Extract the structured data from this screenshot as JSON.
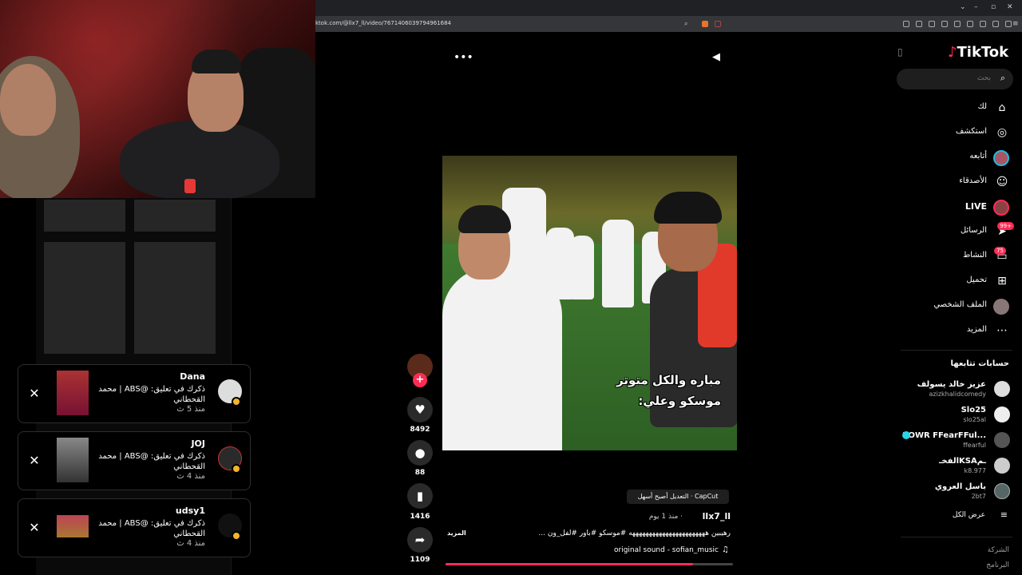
{
  "browser": {
    "url": "ktok.com/@llx7_ll/video/7671406039794961684"
  },
  "tiktok": {
    "logo": "TikTok",
    "search_placeholder": "بحث",
    "nav": [
      {
        "label": "لك",
        "icon": "home-icon"
      },
      {
        "label": "استكشف",
        "icon": "compass-icon"
      },
      {
        "label": "أتابعه",
        "icon": "following-avatar-icon"
      },
      {
        "label": "الأصدقاء",
        "icon": "friends-icon"
      },
      {
        "label": "LIVE",
        "icon": "live-avatar-icon"
      },
      {
        "label": "الرسائل",
        "icon": "messages-icon",
        "badge": "99+"
      },
      {
        "label": "النشاط",
        "icon": "activity-icon",
        "badge": "75"
      },
      {
        "label": "تحميل",
        "icon": "upload-icon"
      },
      {
        "label": "الملف الشخصي",
        "icon": "profile-avatar-icon"
      },
      {
        "label": "المزيد",
        "icon": "more-icon"
      }
    ],
    "following_title": "حسابات تتابعها",
    "following": [
      {
        "name": "عزيز خالد يسولف",
        "user": "azizkhalidcomedy"
      },
      {
        "name": "Slo25",
        "user": "slo25al"
      },
      {
        "name": "POWR FFearFFul...",
        "user": "ffearful"
      },
      {
        "name": "الفخـKSAـم",
        "user": "k8.977"
      },
      {
        "name": "باسل العروي",
        "user": "2bt7"
      }
    ],
    "see_all": "عرض الكل",
    "footer": [
      "الشركة",
      "البرنامج"
    ]
  },
  "video": {
    "overlay_line1": "مباره والكل متوتر",
    "overlay_line2": "موسكو وعلي:",
    "capcut": "CapCut · التعديل أصبح أسهل",
    "author": "llx7_ll",
    "posted": "· منذ 1 يوم",
    "caption": "رهيبين هههههههههههههههههههههههه #موسكو #باور #لفل_ون ...",
    "more": "المزيد",
    "sound": "original sound - sofian_music",
    "likes": "8492",
    "comments": "88",
    "saves": "1416",
    "shares": "1109",
    "progress": 0.86
  },
  "notifications": [
    {
      "name": "Dana",
      "text": "ذكرك في تعليق: @ABS | محمد القحطاني",
      "time": "منذ 5 ث"
    },
    {
      "name": "JOJ",
      "text": "ذكرك في تعليق: @ABS | محمد القحطاني",
      "time": "منذ 4 ث"
    },
    {
      "name": "udsy1",
      "text": "ذكرك في تعليق: @ABS | محمد القحطاني",
      "time": "منذ 4 ث"
    }
  ],
  "colors": {
    "accent": "#fe2c55",
    "coin": "#f5b529"
  }
}
